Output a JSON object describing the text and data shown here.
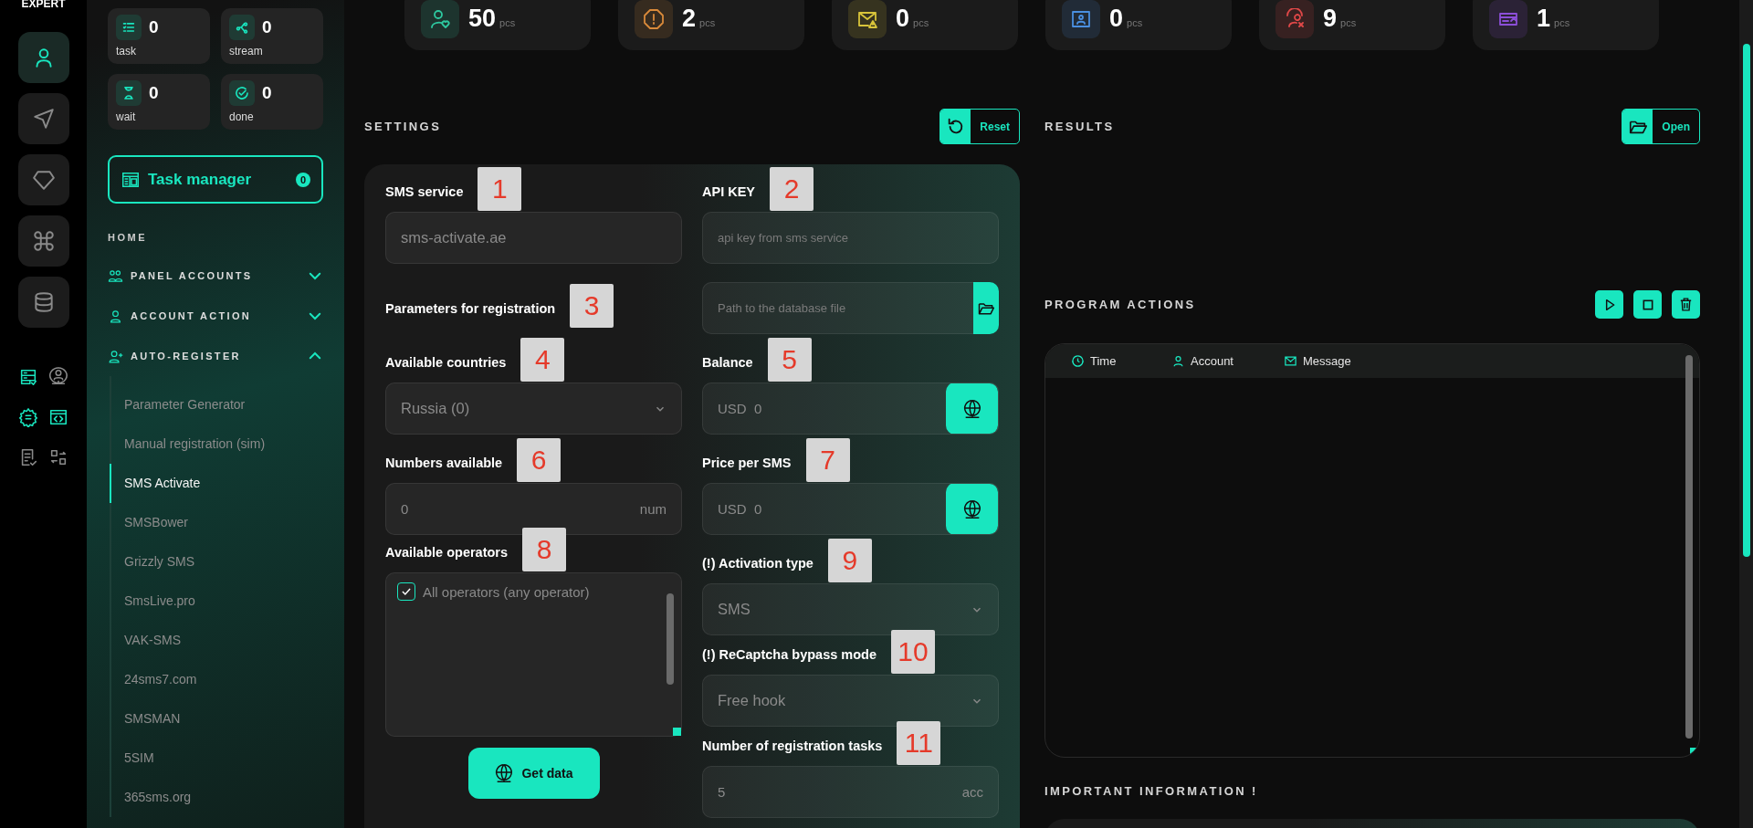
{
  "brand": "EXPERT",
  "rail_buttons": [
    {
      "kind": "user",
      "selected": true
    },
    {
      "kind": "send",
      "selected": false
    },
    {
      "kind": "diamond",
      "selected": false
    },
    {
      "kind": "command",
      "selected": false
    },
    {
      "kind": "database",
      "selected": false
    }
  ],
  "rail_tools": [
    {
      "kind": "server",
      "active": true
    },
    {
      "kind": "network-user",
      "active": false
    },
    {
      "kind": "gear",
      "active": true
    },
    {
      "kind": "code",
      "active": true
    },
    {
      "kind": "checklist",
      "active": false
    },
    {
      "kind": "swap",
      "active": false
    }
  ],
  "counters": [
    {
      "kind": "task",
      "value": "0",
      "label": "task"
    },
    {
      "kind": "stream",
      "value": "0",
      "label": "stream"
    },
    {
      "kind": "wait",
      "value": "0",
      "label": "wait"
    },
    {
      "kind": "done",
      "value": "0",
      "label": "done"
    }
  ],
  "task_manager": {
    "label": "Task manager",
    "count": "0"
  },
  "nav": {
    "home": "HOME",
    "sections": [
      {
        "kind": "group",
        "label": "PANEL ACCOUNTS",
        "expanded": false
      },
      {
        "kind": "user",
        "label": "ACCOUNT ACTION",
        "expanded": false
      },
      {
        "kind": "user-plus",
        "label": "AUTO-REGISTER",
        "expanded": true,
        "children": [
          {
            "label": "Parameter Generator",
            "selected": false
          },
          {
            "label": "Manual registration (sim)",
            "selected": false
          },
          {
            "label": "SMS Activate",
            "selected": true
          },
          {
            "label": "SMSBower",
            "selected": false
          },
          {
            "label": "Grizzly SMS",
            "selected": false
          },
          {
            "label": "SmsLive.pro",
            "selected": false
          },
          {
            "label": "VAK-SMS",
            "selected": false
          },
          {
            "label": "24sms7.com",
            "selected": false
          },
          {
            "label": "SMSMAN",
            "selected": false
          },
          {
            "label": "5SIM",
            "selected": false
          },
          {
            "label": "365sms.org",
            "selected": false
          }
        ]
      }
    ]
  },
  "stats": [
    {
      "kind": "user-heart",
      "value": "50",
      "unit": "pcs",
      "color": "#2ec9a0"
    },
    {
      "kind": "warning",
      "value": "2",
      "unit": "pcs",
      "color": "#d98a3a"
    },
    {
      "kind": "mail-warning",
      "value": "0",
      "unit": "pcs",
      "color": "#d8c43a"
    },
    {
      "kind": "id-card",
      "value": "0",
      "unit": "pcs",
      "color": "#4a8fe0"
    },
    {
      "kind": "user-x",
      "value": "9",
      "unit": "pcs",
      "color": "#e04848"
    },
    {
      "kind": "card",
      "value": "1",
      "unit": "pcs",
      "color": "#8c4fd8"
    }
  ],
  "settings": {
    "title": "SETTINGS",
    "reset": "Reset",
    "left": [
      {
        "kind": "input",
        "label": "SMS service",
        "marker": "1",
        "value": "sms-activate.ae"
      },
      {
        "kind": "heading",
        "label": "Parameters for registration",
        "marker": "3"
      },
      {
        "kind": "select",
        "label": "Available countries",
        "marker": "4",
        "value": "Russia (0)"
      },
      {
        "kind": "number",
        "label": "Numbers available",
        "marker": "6",
        "value": "0",
        "unit": "num"
      },
      {
        "kind": "checklist",
        "label": "Available operators",
        "marker": "8",
        "options": [
          {
            "label": "All operators (any operator)",
            "checked": true
          }
        ]
      }
    ],
    "get_data": "Get data",
    "right": [
      {
        "kind": "input",
        "label": "API KEY",
        "marker": "2",
        "placeholder": "api key from sms service"
      },
      {
        "kind": "file",
        "placeholder": "Path to the database file"
      },
      {
        "kind": "currency",
        "label": "Balance",
        "marker": "5",
        "currency": "USD",
        "value": "0"
      },
      {
        "kind": "currency",
        "label": "Price per SMS",
        "marker": "7",
        "currency": "USD",
        "value": "0"
      },
      {
        "kind": "select",
        "label": "(!) Activation type",
        "marker": "9",
        "value": "SMS"
      },
      {
        "kind": "select",
        "label": "(!) ReCaptcha bypass mode",
        "marker": "10",
        "value": "Free hook"
      },
      {
        "kind": "number",
        "label": "Number of registration tasks",
        "marker": "11",
        "value": "5",
        "unit": "acc"
      }
    ]
  },
  "results": {
    "title": "RESULTS",
    "open": "Open"
  },
  "program_actions": {
    "title": "PROGRAM ACTIONS",
    "columns": [
      {
        "kind": "time",
        "label": "Time"
      },
      {
        "kind": "user",
        "label": "Account"
      },
      {
        "kind": "mail",
        "label": "Message"
      }
    ]
  },
  "important": {
    "title": "IMPORTANT INFORMATION !"
  }
}
